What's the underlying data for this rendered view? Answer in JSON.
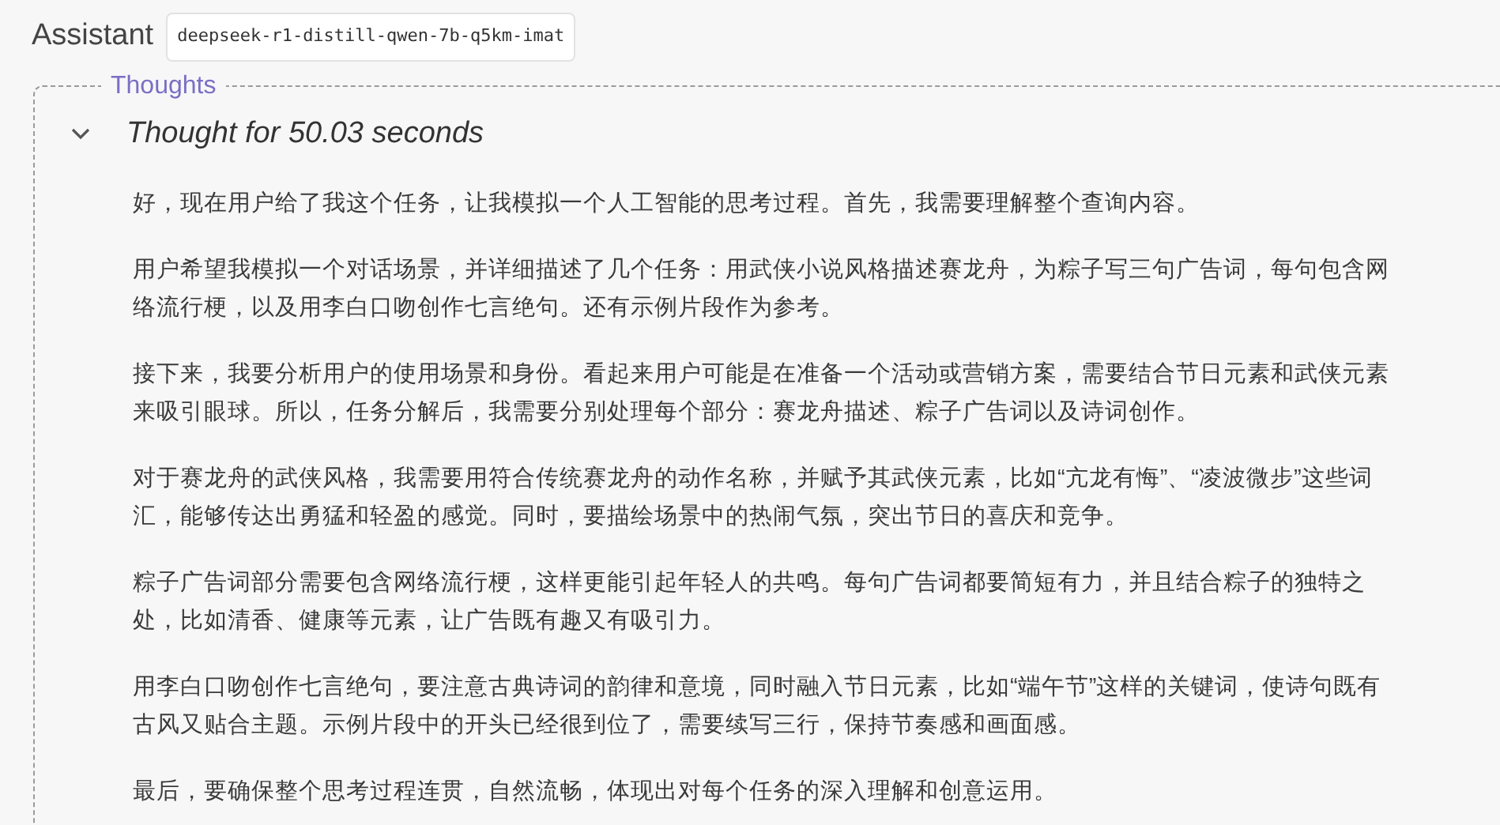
{
  "header": {
    "role": "Assistant",
    "model": "deepseek-r1-distill-qwen-7b-q5km-imat"
  },
  "thoughts": {
    "legend": "Thoughts",
    "expanded": true,
    "summary": "Thought for 50.03 seconds",
    "paragraphs": [
      "好，现在用户给了我这个任务，让我模拟一个人工智能的思考过程。首先，我需要理解整个查询内容。",
      "用户希望我模拟一个对话场景，并详细描述了几个任务：用武侠小说风格描述赛龙舟，为粽子写三句广告词，每句包含网络流行梗，以及用李白口吻创作七言绝句。还有示例片段作为参考。",
      "接下来，我要分析用户的使用场景和身份。看起来用户可能是在准备一个活动或营销方案，需要结合节日元素和武侠元素来吸引眼球。所以，任务分解后，我需要分别处理每个部分：赛龙舟描述、粽子广告词以及诗词创作。",
      "对于赛龙舟的武侠风格，我需要用符合传统赛龙舟的动作名称，并赋予其武侠元素，比如“亢龙有悔”、“凌波微步”这些词汇，能够传达出勇猛和轻盈的感觉。同时，要描绘场景中的热闹气氛，突出节日的喜庆和竞争。",
      "粽子广告词部分需要包含网络流行梗，这样更能引起年轻人的共鸣。每句广告词都要简短有力，并且结合粽子的独特之处，比如清香、健康等元素，让广告既有趣又有吸引力。",
      "用李白口吻创作七言绝句，要注意古典诗词的韵律和意境，同时融入节日元素，比如“端午节”这样的关键词，使诗句既有古风又贴合主题。示例片段中的开头已经很到位了，需要续写三行，保持节奏感和画面感。",
      "最后，要确保整个思考过程连贯，自然流畅，体现出对每个任务的深入理解和创意运用。"
    ]
  }
}
